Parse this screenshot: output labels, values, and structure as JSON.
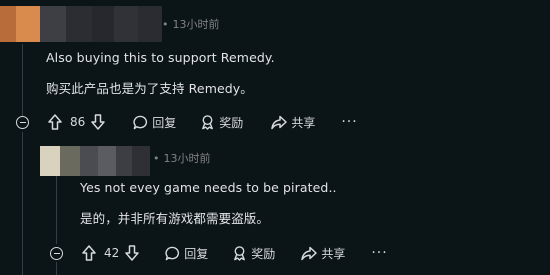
{
  "comment1": {
    "timestamp": "13小时前",
    "text_en": "Also buying this to support Remedy.",
    "text_zh": "购买此产品也是为了支持 Remedy。",
    "votes": "86",
    "reply_label": "回复",
    "award_label": "奖励",
    "share_label": "共享",
    "more_label": "···"
  },
  "comment2": {
    "timestamp": "13小时前",
    "text_en": "Yes not evey game needs to be pirated..",
    "text_zh": "是的，并非所有游戏都需要盗版。",
    "votes": "42",
    "reply_label": "回复",
    "award_label": "奖励",
    "share_label": "共享",
    "more_label": "···"
  },
  "colors": {
    "background": "#0b1416",
    "text": "#d7dadc",
    "muted": "#818384",
    "thread_line": "#343f45"
  },
  "meta_separator": "•"
}
